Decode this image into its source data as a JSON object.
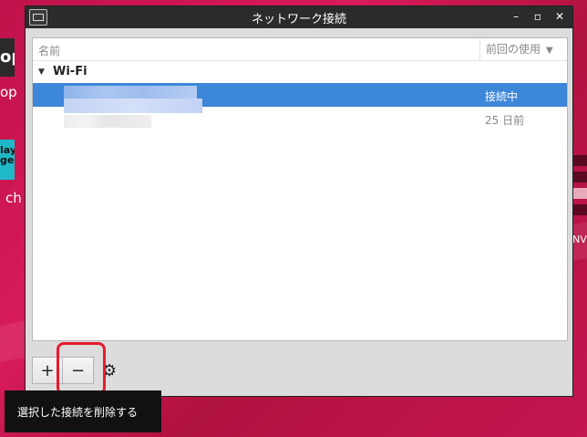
{
  "window": {
    "title": "ネットワーク接続",
    "controls": {
      "minimize": "–",
      "maximize": "▫",
      "close": "✕"
    }
  },
  "columns": {
    "name": "名前",
    "last_used": "前回の使用",
    "sort_indicator": "▼"
  },
  "group": {
    "label": "Wi-Fi",
    "expander": "▼"
  },
  "connections": [
    {
      "status": "接続中",
      "selected": true
    },
    {
      "status": "25 日前",
      "selected": false
    }
  ],
  "toolbar": {
    "add_label": "+",
    "remove_label": "−",
    "settings_label": "⚙"
  },
  "tooltip": {
    "text": "選択した接続を削除する"
  },
  "desktop": {
    "label1": "op",
    "label2": "ch",
    "icon1": "op",
    "icon2": "lay\nge",
    "right_label": "NV"
  },
  "colors": {
    "accent": "#3d87d8",
    "highlight": "#e8192c",
    "desktop_bg": "#c8154e"
  }
}
